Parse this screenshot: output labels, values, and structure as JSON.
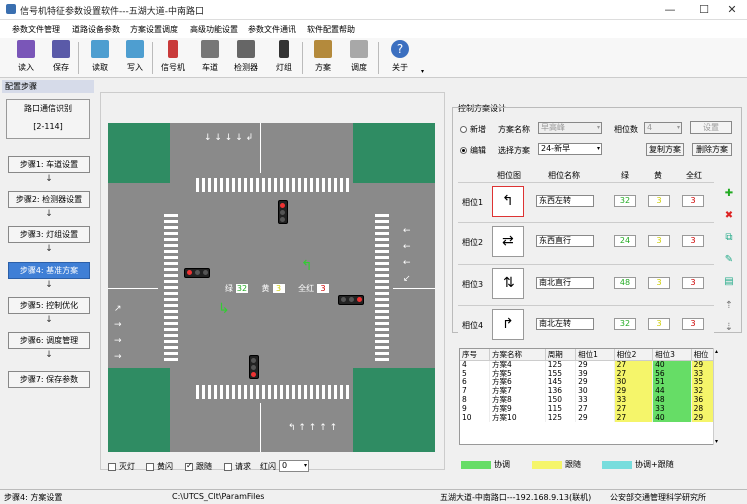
{
  "window": {
    "title": "信号机特征参数设置软件---五湖大道-中南路口"
  },
  "menu": [
    "参数文件管理",
    "道路设备参数",
    "方案设置调度",
    "高级功能设置",
    "参数文件通讯",
    "软件配置帮助"
  ],
  "toolbar": [
    "读入",
    "保存",
    "读取",
    "写入",
    "信号机",
    "车道",
    "检测器",
    "灯组",
    "方案",
    "调度",
    "关于"
  ],
  "left": {
    "header": "配置步骤",
    "id_label": "路口通信识别",
    "id_value": "[2-114]",
    "steps": [
      "步骤1: 车道设置",
      "步骤2: 检测器设置",
      "步骤3: 灯组设置",
      "步骤4: 基准方案",
      "步骤5: 控制优化",
      "步骤6: 调度管理",
      "步骤7: 保存参数"
    ],
    "active_step": 3
  },
  "map_info": {
    "green_label": "绿",
    "green_val": "32",
    "yellow_label": "黄",
    "yellow_val": "3",
    "allred_label": "全红",
    "allred_val": "3"
  },
  "bottom_checks": {
    "items": [
      "灭灯",
      "黄闪",
      "跟随",
      "请求"
    ],
    "checked": [
      false,
      false,
      true,
      false
    ],
    "redflash_label": "红闪",
    "redflash_val": "0"
  },
  "plan": {
    "group_title": "控制方案设计",
    "new_label": "新增",
    "edit_label": "编辑",
    "plan_name_label": "方案名称",
    "plan_name_value": "早高峰",
    "phase_count_label": "相位数",
    "phase_count_value": "4",
    "set_btn": "设置",
    "choose_label": "选择方案",
    "choose_value": "24-新早",
    "copy_btn": "复制方案",
    "delete_btn": "删除方案",
    "col_phase_img": "相位图",
    "col_phase_name": "相位名称",
    "col_green": "绿",
    "col_yellow": "黄",
    "col_allred": "全红",
    "phases": [
      {
        "label": "相位1",
        "name": "东西左转",
        "green": "32",
        "yellow": "3",
        "red": "3"
      },
      {
        "label": "相位2",
        "name": "东西直行",
        "green": "24",
        "yellow": "3",
        "red": "3"
      },
      {
        "label": "相位3",
        "name": "南北直行",
        "green": "48",
        "yellow": "3",
        "red": "3"
      },
      {
        "label": "相位4",
        "name": "南北左转",
        "green": "32",
        "yellow": "3",
        "red": "3"
      }
    ]
  },
  "table": {
    "headers": [
      "序号",
      "方案名称",
      "周期",
      "相位1",
      "相位2",
      "相位3",
      "相位"
    ],
    "rows": [
      [
        "4",
        "方案4",
        "125",
        "29",
        "27",
        "40",
        "29"
      ],
      [
        "5",
        "方案5",
        "155",
        "39",
        "27",
        "56",
        "33"
      ],
      [
        "6",
        "方案6",
        "145",
        "29",
        "30",
        "51",
        "35"
      ],
      [
        "7",
        "方案7",
        "136",
        "30",
        "29",
        "44",
        "32"
      ],
      [
        "8",
        "方案8",
        "150",
        "33",
        "33",
        "48",
        "36"
      ],
      [
        "9",
        "方案9",
        "115",
        "27",
        "27",
        "33",
        "28"
      ],
      [
        "10",
        "方案10",
        "125",
        "29",
        "27",
        "40",
        "29"
      ]
    ]
  },
  "legend": [
    "协调",
    "跟随",
    "协调+跟随"
  ],
  "colors": {
    "coord": "#66dd66",
    "follow": "#f5f56a",
    "coordfollow": "#77dddd",
    "accent": "#3f7fd6",
    "road": "#8a8a8a",
    "grass": "#2f8c63"
  },
  "status": {
    "step": "步骤4: 方案设置",
    "path": "C:\\UTCS_Clt\\ParamFiles",
    "conn": "五湖大道-中南路口---192.168.9.13(联机)",
    "org": "公安部交通管理科学研究所"
  }
}
